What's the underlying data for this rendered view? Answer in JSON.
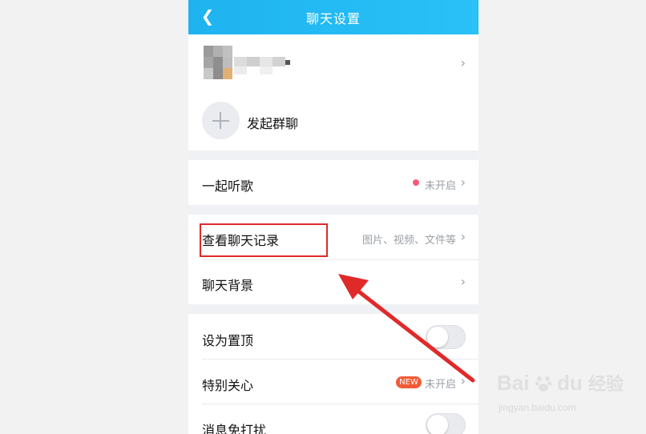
{
  "header": {
    "title": "聊天设置",
    "back_icon": "chevron-left-icon"
  },
  "profile": {
    "blurred_name": "",
    "chevron": "›"
  },
  "group_chat": {
    "label": "发起群聊",
    "icon": "plus-icon"
  },
  "listen_together": {
    "label": "一起听歌",
    "status": "未开启",
    "status_color": "#f55b7a"
  },
  "history": {
    "label": "查看聊天记录",
    "hint": "图片、视频、文件等"
  },
  "background": {
    "label": "聊天背景"
  },
  "pin": {
    "label": "设为置顶",
    "enabled": false
  },
  "special_care": {
    "label": "特别关心",
    "badge": "NEW",
    "status": "未开启"
  },
  "dnd": {
    "label": "消息免打扰",
    "enabled": false
  },
  "annotation": {
    "box_color": "#e02a2a",
    "arrow_color": "#e02a2a"
  },
  "watermark": {
    "brand": "Bai",
    "brand_tail": "du",
    "site_cn": "经验",
    "url": "jingyan.baidu.com"
  }
}
